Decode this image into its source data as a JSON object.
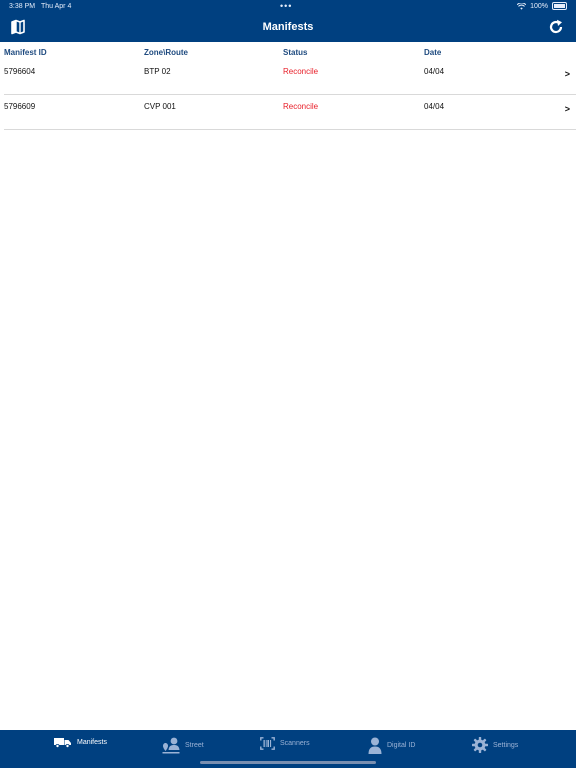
{
  "status_bar": {
    "time": "3:38 PM",
    "date": "Thu Apr 4",
    "dots": "•••",
    "battery": "100%"
  },
  "nav": {
    "title": "Manifests"
  },
  "table": {
    "headers": [
      "Manifest ID",
      "Zone\\Route",
      "Status",
      "Date"
    ],
    "rows": [
      {
        "manifest_id": "5796604",
        "zone_route": "BTP 02",
        "status": "Reconcile",
        "date": "04/04",
        "chevron": ">"
      },
      {
        "manifest_id": "5796609",
        "zone_route": "CVP 001",
        "status": "Reconcile",
        "date": "04/04",
        "chevron": ">"
      }
    ]
  },
  "tabs": [
    {
      "label": "Manifests",
      "icon": "truck-icon",
      "active": true
    },
    {
      "label": "Street",
      "icon": "person-map-icon",
      "active": false
    },
    {
      "label": "Scanners",
      "icon": "barcode-scanner-icon",
      "active": false
    },
    {
      "label": "Digital ID",
      "icon": "person-icon",
      "active": false
    },
    {
      "label": "Settings",
      "icon": "gear-icon",
      "active": false
    }
  ],
  "colors": {
    "bar": "#004080",
    "header_text": "#1e4a7f",
    "status_red": "#e8202a",
    "inactive_tab": "#9bb3d6"
  }
}
